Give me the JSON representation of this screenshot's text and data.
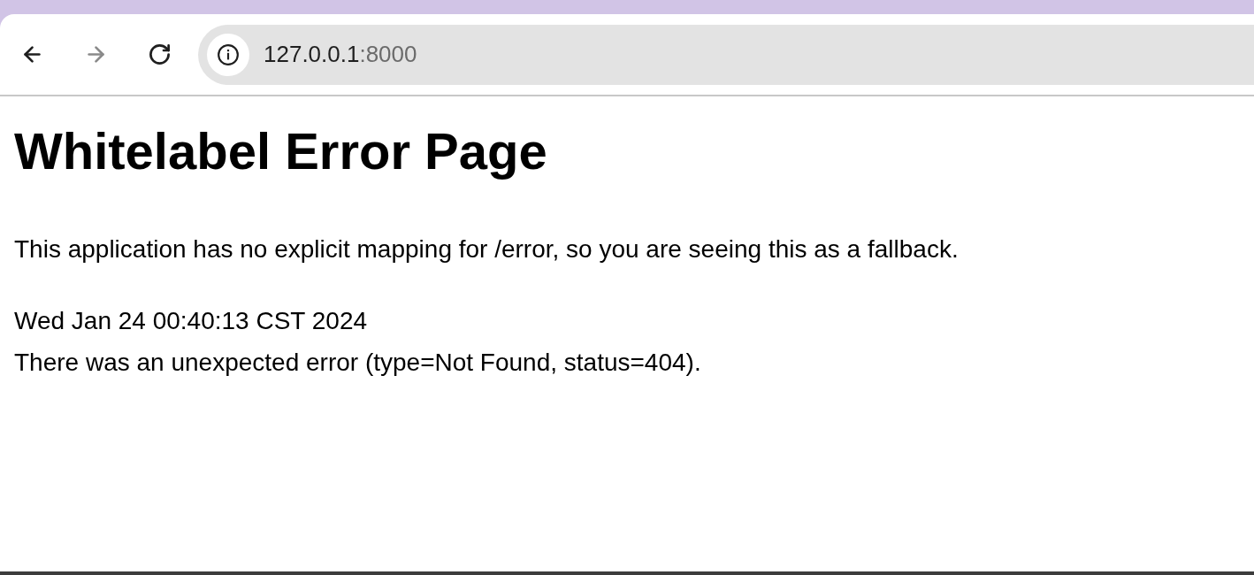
{
  "toolbar": {
    "buttons": [
      {
        "kind": "back",
        "disabled": false
      },
      {
        "kind": "forward",
        "disabled": true
      },
      {
        "kind": "reload",
        "disabled": false
      }
    ],
    "address": {
      "host": "127.0.0.1",
      "port": ":8000"
    }
  },
  "page": {
    "title": "Whitelabel Error Page",
    "message": "This application has no explicit mapping for /error, so you are seeing this as a fallback.",
    "lines": [
      "Wed Jan 24 00:40:13 CST 2024",
      "There was an unexpected error (type=Not Found, status=404)."
    ]
  }
}
